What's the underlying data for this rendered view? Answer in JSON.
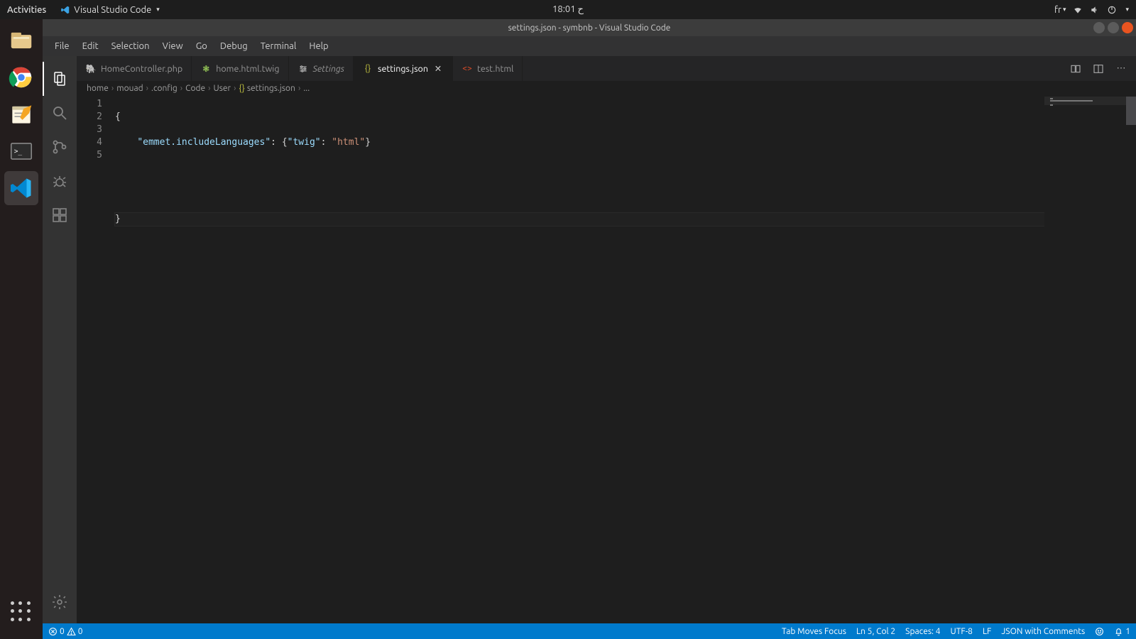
{
  "gnome": {
    "activities": "Activities",
    "app_label": "Visual Studio Code",
    "clock": "ح 18:01",
    "lang": "fr"
  },
  "titlebar": {
    "title": "settings.json - symbnb - Visual Studio Code"
  },
  "menu": {
    "file": "File",
    "edit": "Edit",
    "selection": "Selection",
    "view": "View",
    "go": "Go",
    "debug": "Debug",
    "terminal": "Terminal",
    "help": "Help"
  },
  "tabs": {
    "t0": {
      "label": "HomeController.php"
    },
    "t1": {
      "label": "home.html.twig"
    },
    "t2": {
      "label": "Settings"
    },
    "t3": {
      "label": "settings.json"
    },
    "t4": {
      "label": "test.html"
    }
  },
  "breadcrumbs": {
    "b0": "home",
    "b1": "mouad",
    "b2": ".config",
    "b3": "Code",
    "b4": "User",
    "b5": "settings.json",
    "b6": "..."
  },
  "editor": {
    "line_numbers": {
      "l1": "1",
      "l2": "2",
      "l3": "3",
      "l4": "4",
      "l5": "5"
    },
    "l1_brace_open": "{",
    "l2_indent": "    ",
    "l2_key": "\"emmet.includeLanguages\"",
    "l2_colon": ": ",
    "l2_brace2_open": "{",
    "l2_k2": "\"twig\"",
    "l2_colon2": ": ",
    "l2_v2": "\"html\"",
    "l2_brace2_close": "}",
    "l5_brace_close": "}"
  },
  "status": {
    "errors": "0",
    "warnings": "0",
    "tabmoves": "Tab Moves Focus",
    "ln_col": "Ln 5, Col 2",
    "spaces": "Spaces: 4",
    "enc": "UTF-8",
    "eol": "LF",
    "lang": "JSON with Comments",
    "bell": "1"
  }
}
